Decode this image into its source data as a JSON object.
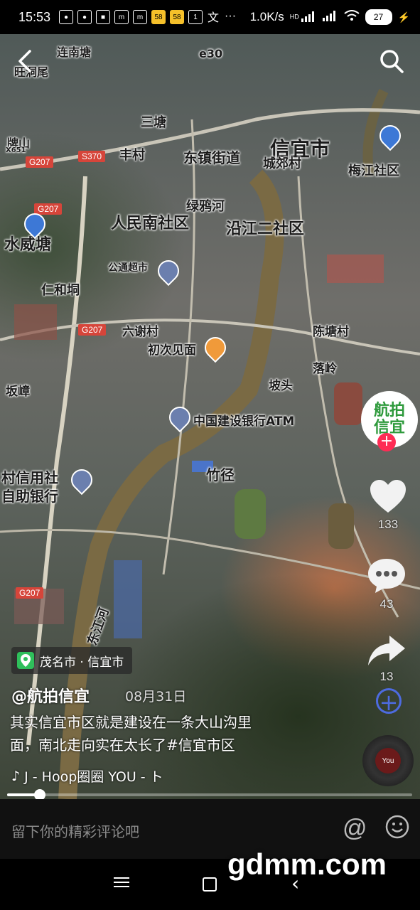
{
  "status_bar": {
    "time": "15:53",
    "net_speed": "1.0K/s",
    "net_badge": "HD",
    "battery": "27",
    "notif_icons": [
      "wechat-icon",
      "wechat-icon",
      "shopping-bag-icon",
      "mi-icon",
      "mi-icon",
      "58-icon",
      "58-icon",
      "1-icon",
      "text-icon"
    ],
    "notif_58": "58",
    "notif_1": "1",
    "notif_text": "文"
  },
  "map": {
    "labels": {
      "xinyi_city": "信宜市",
      "chengjiao": "城郊村",
      "dongzhen_jiedao": "东镇街道",
      "fengcun": "丰村",
      "sanwei": "三塘",
      "renmin_nan": "人民南社区",
      "yanjiang_er": "沿江二社区",
      "lvyu_he": "绿鸦河",
      "shuiwei_tang": "水威塘",
      "renhe_dong": "仁和垌",
      "liuxie_cun": "六谢村",
      "gonghui_chaoshi": "公通超市",
      "chuci_jianmian": "初次见面",
      "zhongguo_jianshe": "中国建设银行ATM",
      "potou": "坡头",
      "zhujing": "竹径",
      "cunxin_yongshe": "村信用社",
      "zizhu_yinhang": "自助银行",
      "dongjiang_he": "东江河",
      "chengtang_cun": "陈塘村",
      "luoling": "落岭",
      "potang": "坂嶂",
      "meijiang_shequ": "梅江社区",
      "lianshan": "连南塘",
      "xiadong": "旺洞尾",
      "dongshan": "牌山",
      "x651": "X651",
      "e30": "e30"
    },
    "route_tags": [
      "G207",
      "S370",
      "G207",
      "G207",
      "G207"
    ]
  },
  "video": {
    "location": "茂名市 · 信宜市",
    "author": "@航拍信宜",
    "date": "08月31日",
    "caption_line1": "其实信宜市区就是建设在一条大山沟里",
    "caption_line2": "面，南北走向实在太长了#信宜市区",
    "music": "J - Hoop圈圈    YOU - ト",
    "progress": 0.08,
    "avatar_text": "航拍信宜",
    "likes": "133",
    "comments": "43",
    "shares": "13",
    "disc_text": "You"
  },
  "comment_bar": {
    "placeholder": "留下你的精彩评论吧",
    "at": "@"
  },
  "watermark": "gdmm.com"
}
